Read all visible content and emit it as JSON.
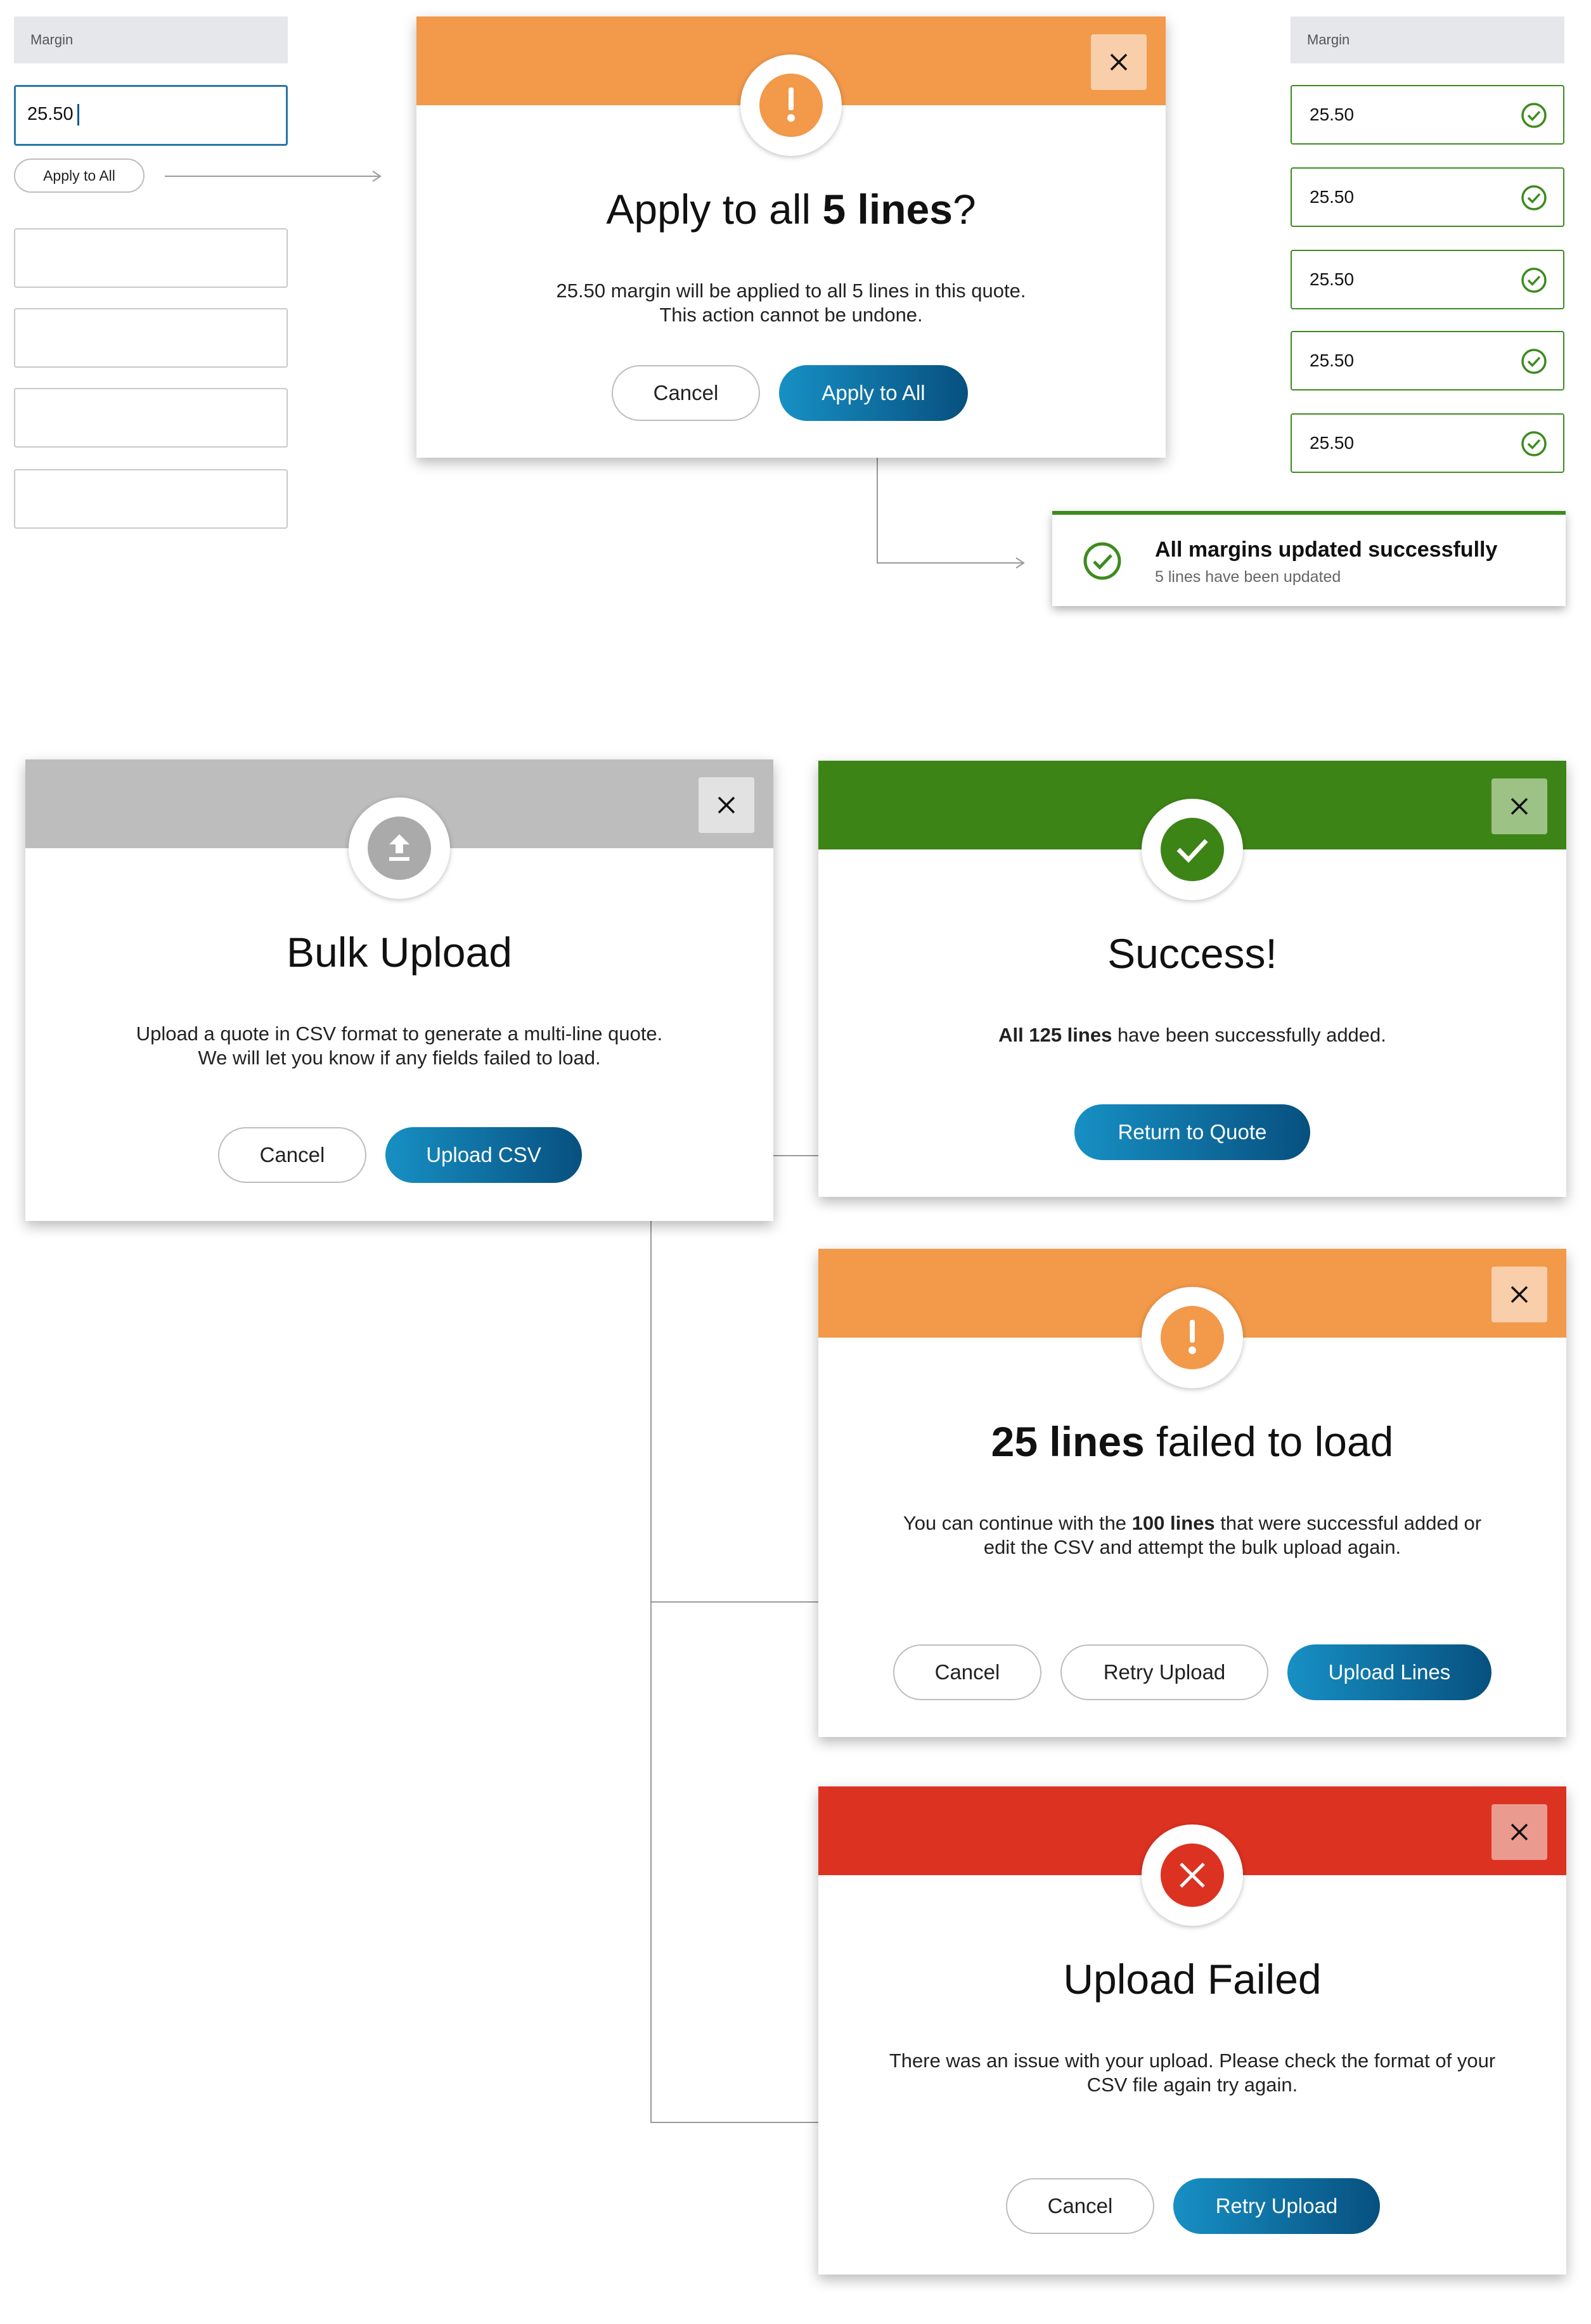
{
  "top_left": {
    "label": "Margin",
    "input_value": "25.50",
    "apply_button": "Apply to All"
  },
  "apply_modal": {
    "title_pre": "Apply to all ",
    "title_bold": "5 lines",
    "title_post": "?",
    "body_line1": "25.50 margin will be applied to all 5 lines in this quote.",
    "body_line2": "This action cannot be undone.",
    "cancel": "Cancel",
    "confirm": "Apply to All",
    "close_icon": "×",
    "alert_glyph": "!"
  },
  "top_right": {
    "label": "Margin",
    "values": [
      "25.50",
      "25.50",
      "25.50",
      "25.50",
      "25.50"
    ]
  },
  "toast": {
    "title": "All margins updated successfully",
    "subtitle": "5 lines have been updated"
  },
  "bulk_modal": {
    "title": "Bulk Upload",
    "body_line1": "Upload a quote in CSV format to generate a multi-line quote.",
    "body_line2": "We will let you know if any fields failed to load.",
    "cancel": "Cancel",
    "confirm": "Upload CSV",
    "close_icon": "×"
  },
  "success_modal": {
    "title": "Success!",
    "body_bold": "All 125 lines",
    "body_rest": " have been successfully added.",
    "confirm": "Return to Quote",
    "close_icon": "×"
  },
  "partial_modal": {
    "title_bold": "25 lines",
    "title_rest": " failed to load",
    "body_pre": "You can continue with the ",
    "body_bold": "100 lines",
    "body_post": " that were successful added or",
    "body_line2": "edit the CSV and attempt the bulk upload again.",
    "cancel": "Cancel",
    "retry": "Retry Upload",
    "confirm": "Upload Lines",
    "close_icon": "×",
    "alert_glyph": "!"
  },
  "failed_modal": {
    "title": "Upload Failed",
    "body_line1": "There was an issue with your upload. Please check the format of your",
    "body_line2": "CSV file again try again.",
    "cancel": "Cancel",
    "retry": "Retry Upload",
    "close_icon": "×"
  },
  "colors": {
    "orange": "#f2994a",
    "green": "#3d8417",
    "red": "#dc3221",
    "gray": "#bdbdbd",
    "primary": "#0b6a9c"
  }
}
